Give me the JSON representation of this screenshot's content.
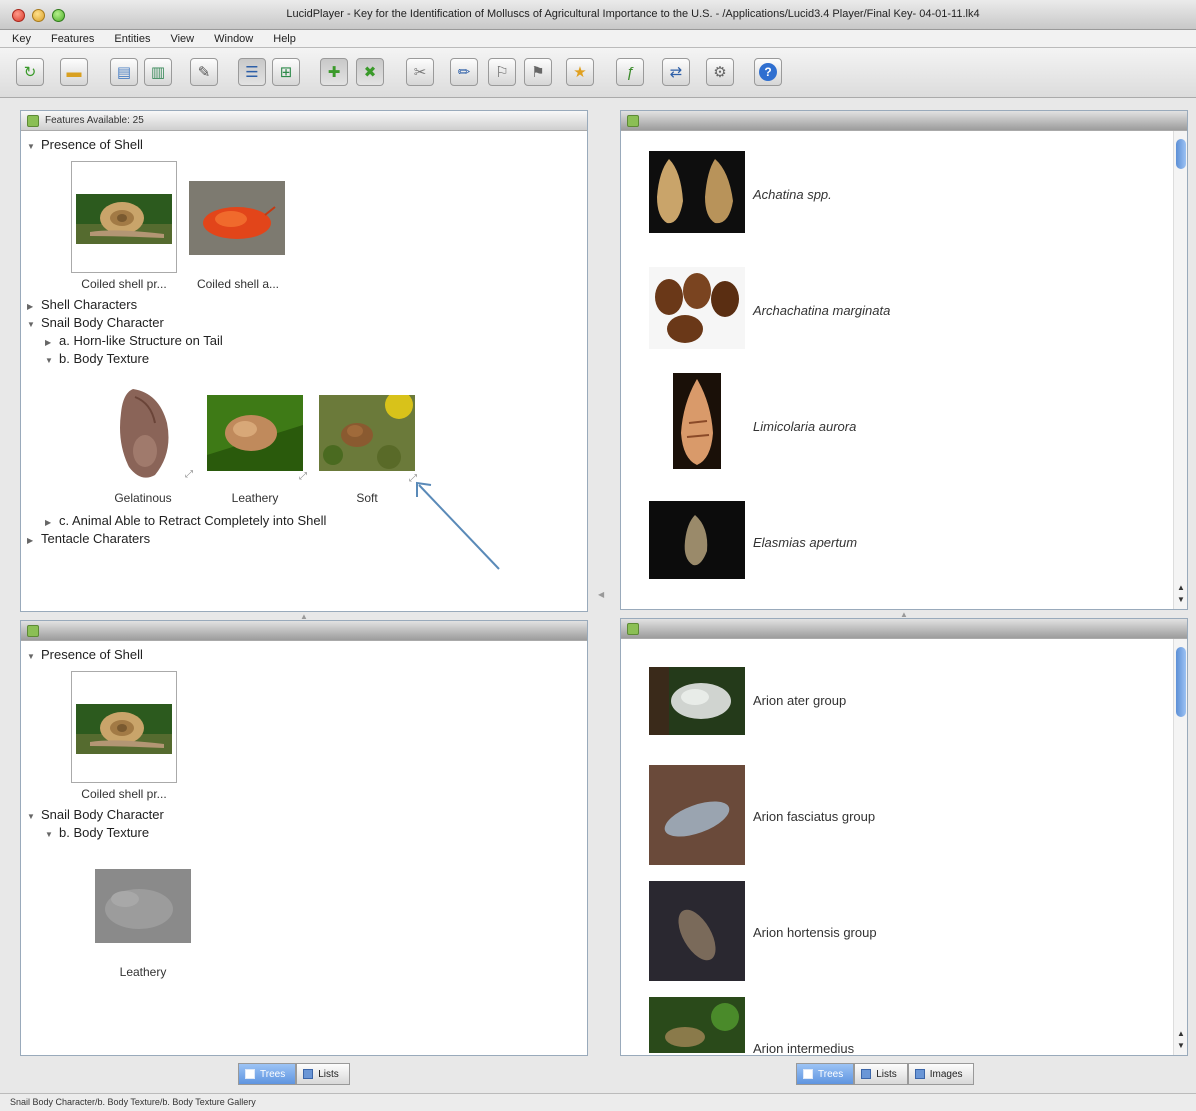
{
  "window": {
    "title": "LucidPlayer - Key for the Identification of Molluscs of Agricultural Importance to the U.S. - /Applications/Lucid3.4 Player/Final Key- 04-01-11.lk4"
  },
  "menu": [
    "Key",
    "Features",
    "Entities",
    "View",
    "Window",
    "Help"
  ],
  "toolbar_icons": [
    "restart-icon",
    "open-folder-icon",
    "features-icon",
    "entities-icon",
    "notes-icon",
    "list-view-icon",
    "tree-view-icon",
    "available-icon",
    "discarded-icon",
    "pin-icon",
    "pencil-icon",
    "best-icon",
    "prune-icon",
    "star-icon",
    "fx-icon",
    "diff-icon",
    "settings-icon",
    "help-icon"
  ],
  "features_panel": {
    "header": "Features Available: 25",
    "presence_of_shell": "Presence of Shell",
    "thumbs_1": [
      "Coiled shell pr...",
      "Coiled shell a..."
    ],
    "shell_characters": "Shell Characters",
    "snail_body_character": "Snail Body Character",
    "horn_like": "a. Horn-like Structure on Tail",
    "body_texture": "b. Body Texture",
    "thumbs_2": [
      "Gelatinous",
      "Leathery",
      "Soft"
    ],
    "retract": "c. Animal Able to Retract Completely into Shell",
    "tentacle": "Tentacle Charaters"
  },
  "chosen_panel": {
    "presence_of_shell": "Presence of Shell",
    "thumb_1": "Coiled shell pr...",
    "snail_body_character": "Snail Body Character",
    "body_texture": "b. Body Texture",
    "thumb_2": "Leathery"
  },
  "entities_remaining": {
    "items": [
      "Achatina spp.",
      "Archachatina marginata",
      "Limicolaria aurora",
      "Elasmias apertum"
    ]
  },
  "entities_discarded": {
    "items": [
      "Arion ater group",
      "Arion fasciatus group",
      "Arion hortensis group",
      "Arion intermedius"
    ]
  },
  "left_tabs": [
    "Trees",
    "Lists"
  ],
  "right_tabs": [
    "Trees",
    "Lists",
    "Images"
  ],
  "status": "Snail Body Character/b. Body Texture/b. Body Texture Gallery"
}
